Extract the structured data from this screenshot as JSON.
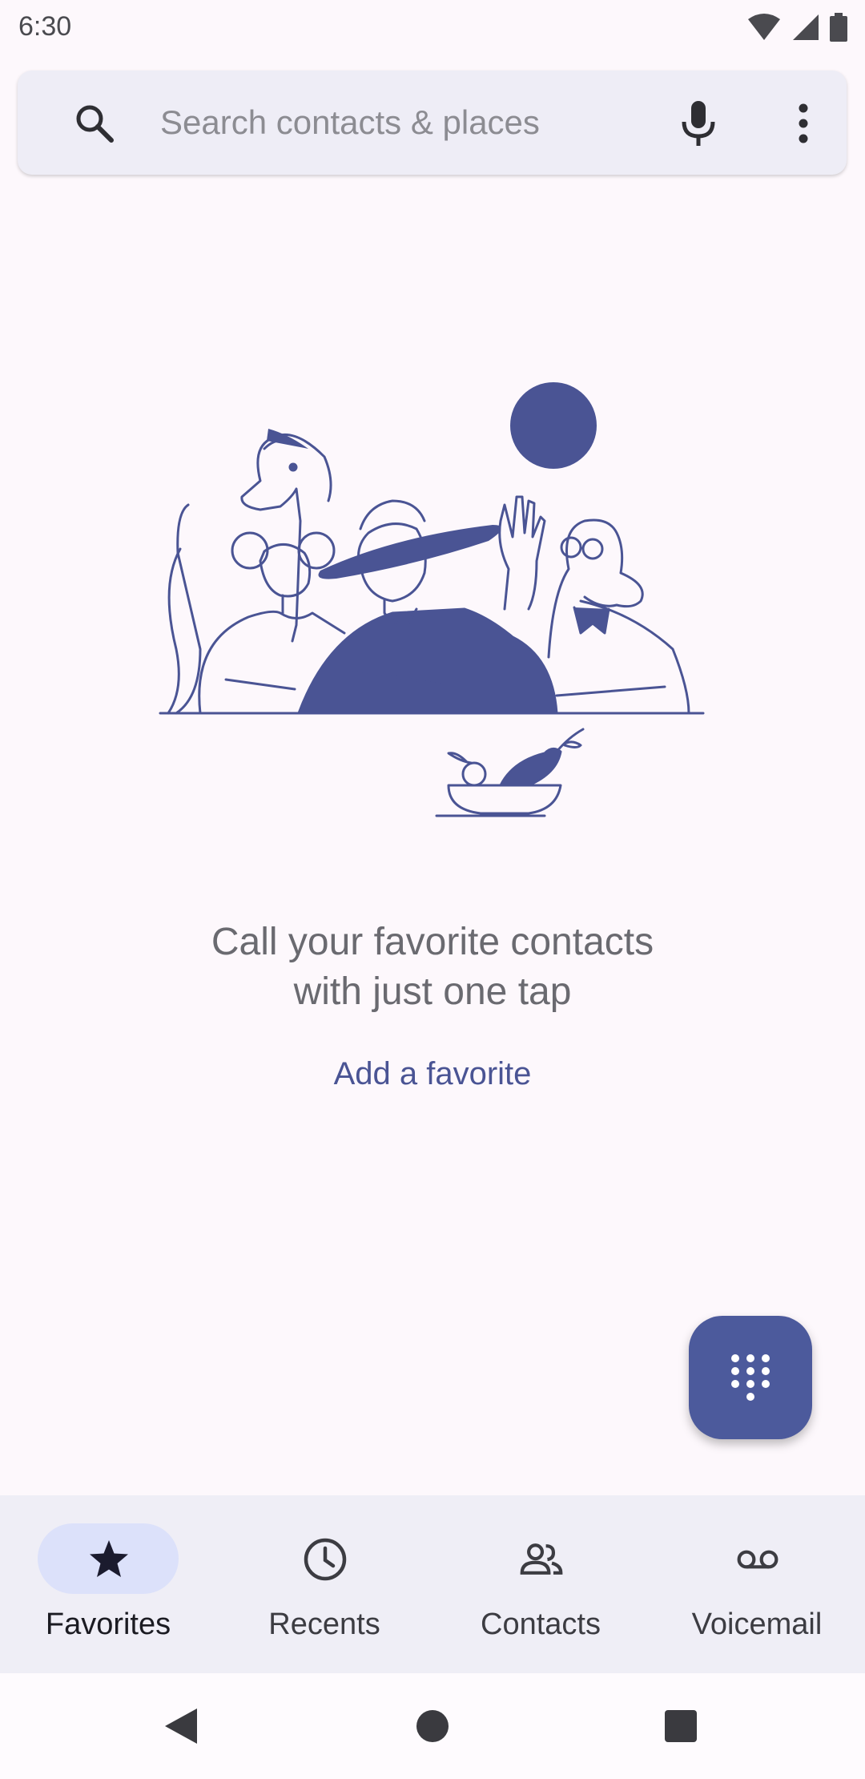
{
  "status_bar": {
    "time": "6:30"
  },
  "search": {
    "placeholder": "Search contacts & places",
    "value": ""
  },
  "empty_state": {
    "message": "Call your favorite contacts\nwith just one tap",
    "action_label": "Add a favorite"
  },
  "fab": {
    "icon": "dialpad-icon"
  },
  "bottom_nav": {
    "items": [
      {
        "label": "Favorites",
        "icon": "star-icon",
        "active": true
      },
      {
        "label": "Recents",
        "icon": "clock-icon",
        "active": false
      },
      {
        "label": "Contacts",
        "icon": "people-icon",
        "active": false
      },
      {
        "label": "Voicemail",
        "icon": "voicemail-icon",
        "active": false
      }
    ]
  },
  "colors": {
    "accent": "#4C5A9C",
    "background": "#FDF8FC",
    "search_bg": "#EEEDF6",
    "nav_bg": "#EFEEF6",
    "active_pill": "#DCE1FA"
  }
}
